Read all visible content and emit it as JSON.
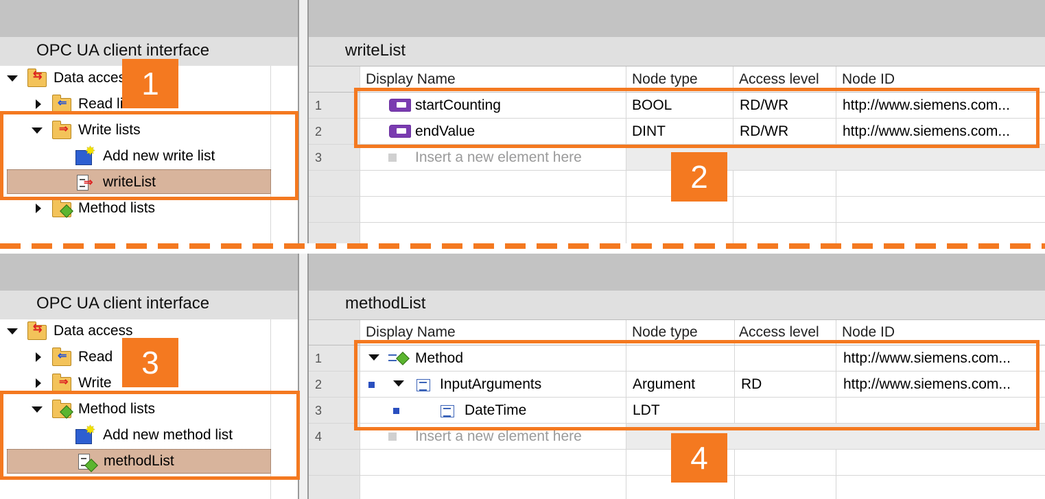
{
  "top": {
    "left_panel": {
      "title": "OPC UA client interface",
      "tree": [
        {
          "label": "Data access",
          "icon": "data-access-folder-icon",
          "expanded": true
        },
        {
          "label": "Read lists",
          "icon": "read-lists-folder-icon",
          "expanded": false
        },
        {
          "label": "Write lists",
          "icon": "write-lists-folder-icon",
          "expanded": true
        },
        {
          "label": "Add new write list",
          "icon": "add-new-icon"
        },
        {
          "label": "writeList",
          "icon": "write-list-icon",
          "selected": true
        },
        {
          "label": "Method lists",
          "icon": "method-lists-folder-icon",
          "expanded": false
        }
      ]
    },
    "right_panel": {
      "title": "writeList",
      "columns": [
        "Display Name",
        "Node type",
        "Access level",
        "Node ID"
      ],
      "rows": [
        {
          "num": "1",
          "name": "startCounting",
          "type": "BOOL",
          "access": "RD/WR",
          "node_id": "http://www.siemens.com..."
        },
        {
          "num": "2",
          "name": "endValue",
          "type": "DINT",
          "access": "RD/WR",
          "node_id": "http://www.siemens.com..."
        },
        {
          "num": "3",
          "name": "Insert a new element here",
          "type": "",
          "access": "",
          "node_id": ""
        }
      ]
    },
    "badges": [
      "1",
      "2"
    ]
  },
  "bottom": {
    "left_panel": {
      "title": "OPC UA client interface",
      "tree": [
        {
          "label": "Data access",
          "icon": "data-access-folder-icon",
          "expanded": true
        },
        {
          "label": "Read",
          "icon": "read-lists-folder-icon",
          "expanded": false
        },
        {
          "label": "Write",
          "icon": "write-lists-folder-icon",
          "expanded": false
        },
        {
          "label": "Method lists",
          "icon": "method-lists-folder-icon",
          "expanded": true
        },
        {
          "label": "Add new method list",
          "icon": "add-new-icon"
        },
        {
          "label": "methodList",
          "icon": "method-list-icon",
          "selected": true
        }
      ]
    },
    "right_panel": {
      "title": "methodList",
      "columns": [
        "Display Name",
        "Node type",
        "Access level",
        "Node ID"
      ],
      "rows": [
        {
          "num": "1",
          "name": "Method",
          "type": "",
          "access": "",
          "node_id": "http://www.siemens.com..."
        },
        {
          "num": "2",
          "name": "InputArguments",
          "type": "Argument",
          "access": "RD",
          "node_id": "http://www.siemens.com..."
        },
        {
          "num": "3",
          "name": "DateTime",
          "type": "LDT",
          "access": "",
          "node_id": ""
        },
        {
          "num": "4",
          "name": "Insert a new element here",
          "type": "",
          "access": "",
          "node_id": ""
        }
      ]
    },
    "badges": [
      "3",
      "4"
    ]
  },
  "colors": {
    "highlight": "#f47920",
    "selection": "#d8b49c",
    "header_bar": "#c3c3c3"
  }
}
